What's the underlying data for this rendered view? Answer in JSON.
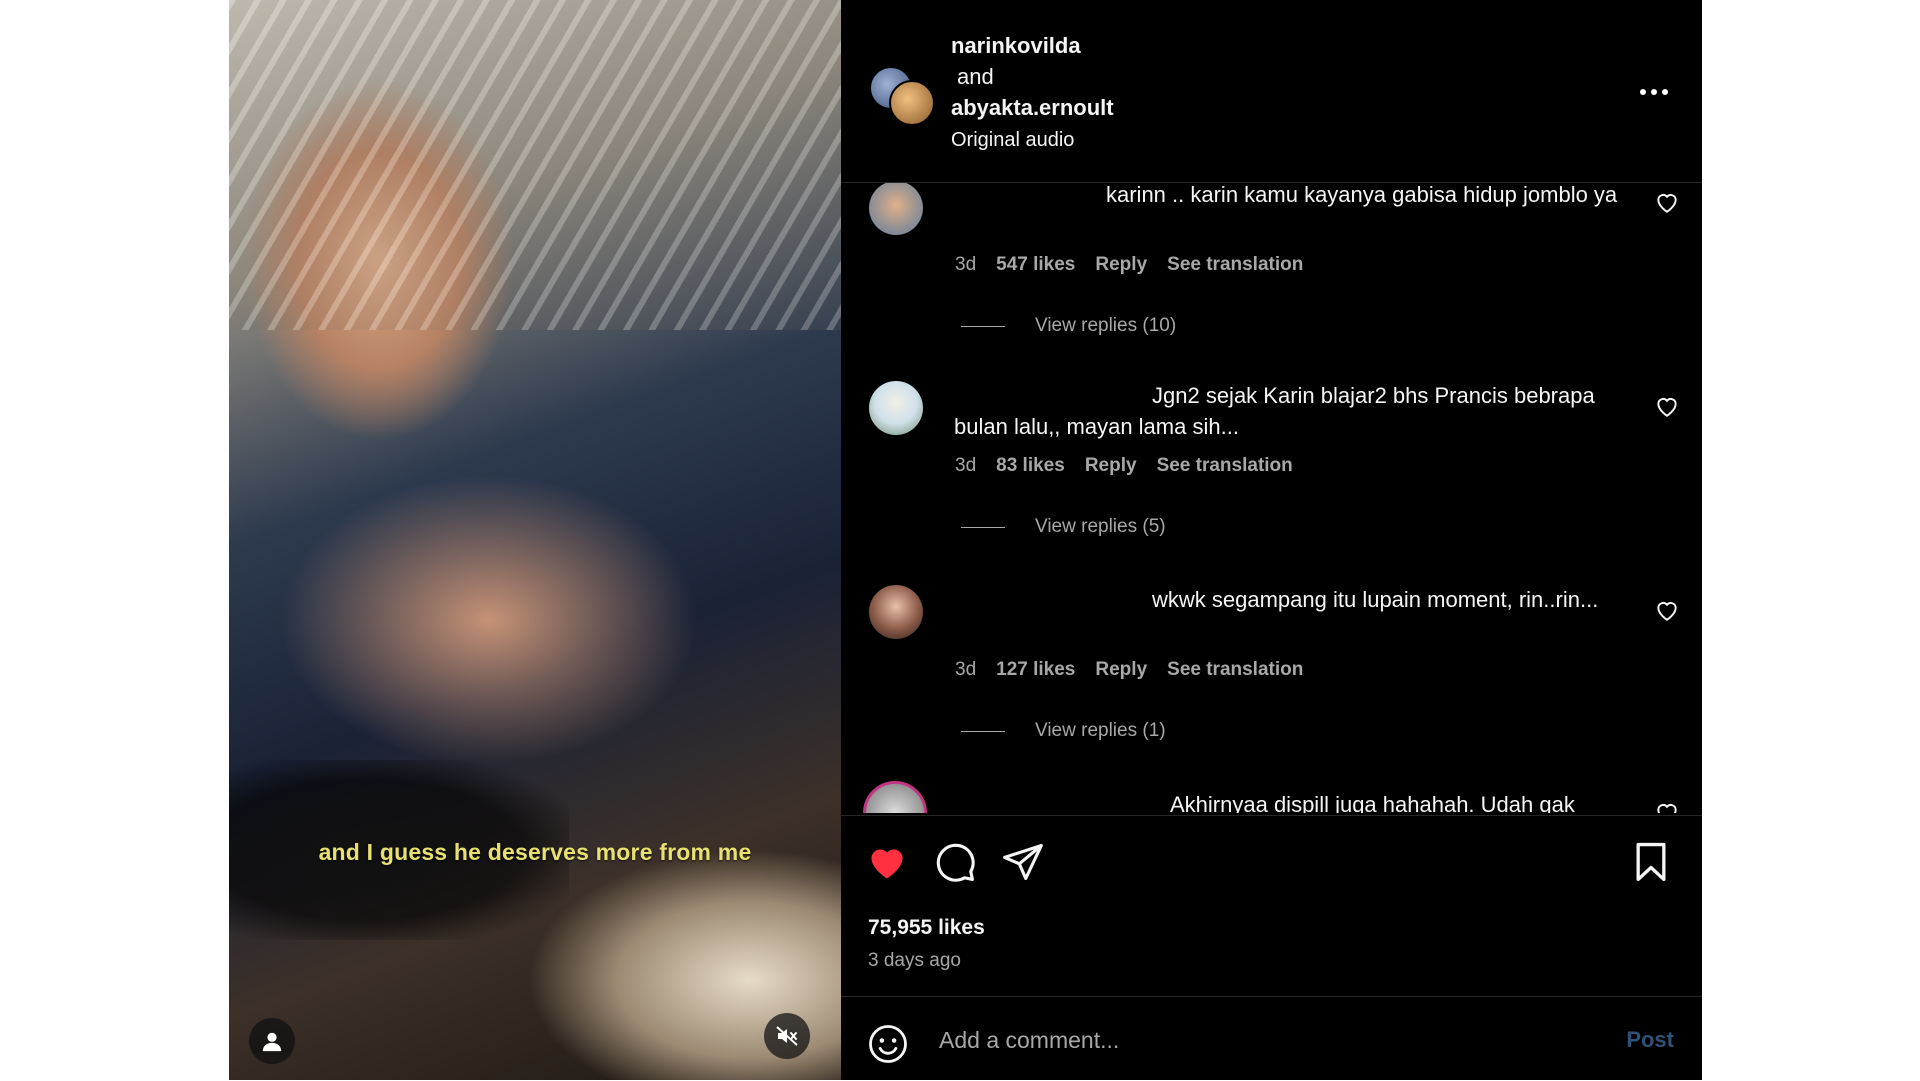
{
  "post": {
    "caption_overlay": "and I guess he deserves more from me"
  },
  "header": {
    "user1": "narinkovilda",
    "connector": "and",
    "user2": "abyakta.ernoult",
    "audio": "Original audio"
  },
  "comments": [
    {
      "text": "karinn .. karin kamu kayanya gabisa hidup jomblo ya",
      "age": "3d",
      "likes": "547 likes",
      "reply": "Reply",
      "translate": "See translation",
      "view_replies": "View replies (10)"
    },
    {
      "text": "Jgn2 sejak Karin blajar2 bhs Prancis bebrapa bulan lalu,, mayan lama sih...",
      "age": "3d",
      "likes": "83 likes",
      "reply": "Reply",
      "translate": "See translation",
      "view_replies": "View replies (5)"
    },
    {
      "text": "wkwk segampang itu lupain moment, rin..rin...",
      "age": "3d",
      "likes": "127 likes",
      "reply": "Reply",
      "translate": "See translation",
      "view_replies": "View replies (1)"
    },
    {
      "text": "Akhirnyaa dispill juga hahahah. Udah gak"
    }
  ],
  "actions": {
    "like_count": "75,955 likes",
    "time_ago": "3 days ago",
    "liked_color": "#ff3040"
  },
  "compose": {
    "placeholder": "Add a comment...",
    "post_label": "Post"
  },
  "icons": [
    "more-icon",
    "heart-icon",
    "comment-icon",
    "share-icon",
    "bookmark-icon",
    "emoji-icon",
    "user-icon",
    "muted-speaker-icon"
  ]
}
